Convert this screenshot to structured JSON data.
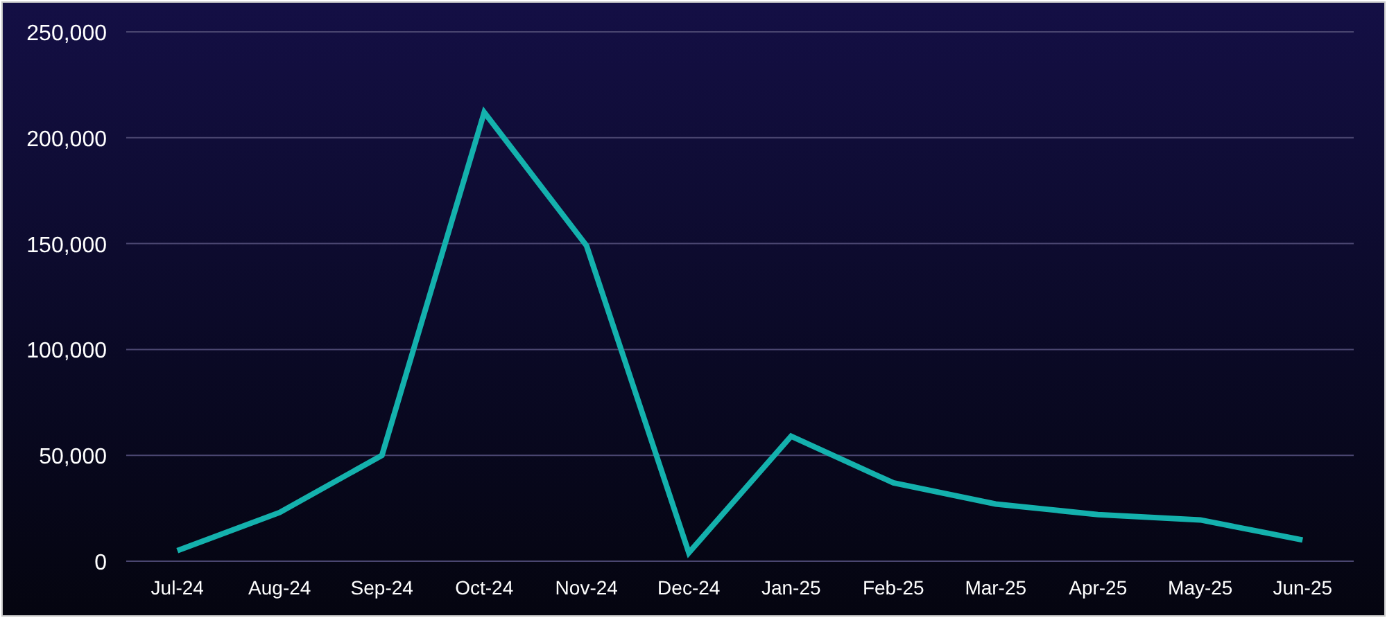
{
  "chart_data": {
    "type": "line",
    "categories": [
      "Jul-24",
      "Aug-24",
      "Sep-24",
      "Oct-24",
      "Nov-24",
      "Dec-24",
      "Jan-25",
      "Feb-25",
      "Mar-25",
      "Apr-25",
      "May-25",
      "Jun-25"
    ],
    "grid": true,
    "series": [
      {
        "color": "#14b1ad",
        "values": [
          5000,
          23000,
          50000,
          212000,
          149000,
          4000,
          59000,
          37000,
          27000,
          22000,
          19500,
          10000
        ]
      }
    ],
    "ylim": [
      0,
      250000
    ],
    "yticks": [
      {
        "value": 0,
        "label": "0"
      },
      {
        "value": 50000,
        "label": "50,000"
      },
      {
        "value": 100000,
        "label": "100,000"
      },
      {
        "value": 150000,
        "label": "150,000"
      },
      {
        "value": 200000,
        "label": "200,000"
      },
      {
        "value": 250000,
        "label": "250,000"
      }
    ]
  }
}
